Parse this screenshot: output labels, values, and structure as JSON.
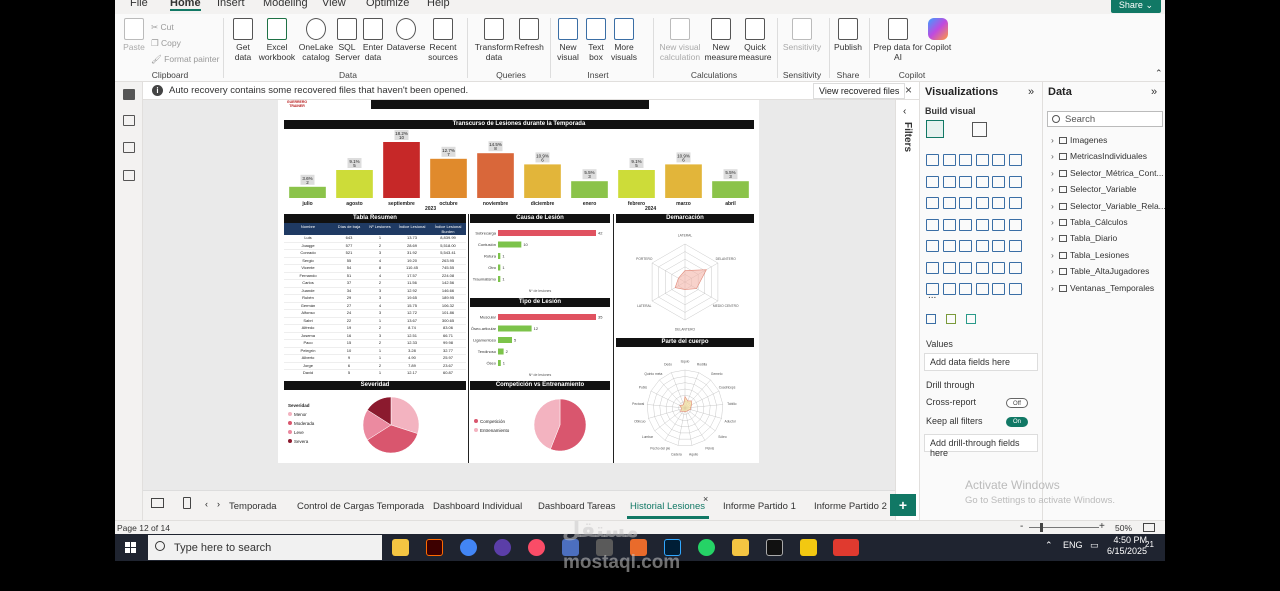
{
  "menu": {
    "items": [
      "File",
      "Home",
      "Insert",
      "Modeling",
      "View",
      "Optimize",
      "Help"
    ],
    "active": "Home",
    "share_label": "Share"
  },
  "ribbon": {
    "clipboard": {
      "paste": "Paste",
      "cut": "Cut",
      "copy": "Copy",
      "format_painter": "Format painter",
      "label": "Clipboard"
    },
    "data": {
      "get_data": "Get data",
      "excel": "Excel workbook",
      "onelake": "OneLake catalog",
      "sql": "SQL Server",
      "enter": "Enter data",
      "dataverse": "Dataverse",
      "recent": "Recent sources",
      "label": "Data"
    },
    "queries": {
      "transform": "Transform data",
      "refresh": "Refresh",
      "label": "Queries"
    },
    "insert": {
      "new_visual": "New visual",
      "text_box": "Text box",
      "more_visuals": "More visuals",
      "label": "Insert"
    },
    "calculations": {
      "new_visual_calc": "New visual calculation",
      "new_measure": "New measure",
      "quick_measure": "Quick measure",
      "label": "Calculations"
    },
    "sensitivity": {
      "sensitivity": "Sensitivity",
      "label": "Sensitivity"
    },
    "share": {
      "publish": "Publish",
      "label": "Share"
    },
    "copilot": {
      "prep": "Prep data for AI",
      "copilot": "Copilot",
      "label": "Copilot"
    }
  },
  "infobar": {
    "message": "Auto recovery contains some recovered files that haven't been opened.",
    "button": "View recovered files"
  },
  "report": {
    "logo_text": "GUERRERO TRAINER",
    "title_bar": "Transcurso de Lesiones durante la Temporada",
    "year_left": "2023",
    "year_right": "2024",
    "tabla_resumen": "Tabla Resumen",
    "causa_title": "Causa de Lesión",
    "tipo_title": "Tipo de Lesión",
    "demarcacion_title": "Demarcación",
    "parte_title": "Parte del cuerpo",
    "severidad_title": "Severidad",
    "comp_title": "Competición vs Entrenamiento",
    "n_lesiones": "Nº de lesiones",
    "table_headers": [
      "Nombre",
      "Días de baja",
      "Nº Lesiones",
      "Índice Lesional",
      "Índice Lesional Burden"
    ],
    "table_rows": [
      [
        "Luis",
        "643",
        "1",
        "13.73",
        "8,839.99"
      ],
      [
        "Joaqge",
        "577",
        "2",
        "28.69",
        "5,518.00"
      ],
      [
        "Conrado",
        "521",
        "3",
        "31.92",
        "5,543.41"
      ],
      [
        "Sergio",
        "55",
        "4",
        "19.20",
        "263.95"
      ],
      [
        "Vicente",
        "54",
        "8",
        "110.45",
        "745.55"
      ],
      [
        "Fernando",
        "51",
        "4",
        "17.57",
        "224.08"
      ],
      [
        "Carlos",
        "37",
        "2",
        "11.56",
        "142.56"
      ],
      [
        "Juande",
        "34",
        "3",
        "12.92",
        "146.66"
      ],
      [
        "Rubén",
        "29",
        "3",
        "19.65",
        "189.95"
      ],
      [
        "Germán",
        "27",
        "4",
        "15.75",
        "106.32"
      ],
      [
        "Alfonso",
        "24",
        "3",
        "12.72",
        "101.86"
      ],
      [
        "Sabri",
        "22",
        "1",
        "13.67",
        "300.65"
      ],
      [
        "Alfredo",
        "19",
        "2",
        "8.74",
        "83.06"
      ],
      [
        "Josema",
        "16",
        "3",
        "12.51",
        "66.71"
      ],
      [
        "Paco",
        "15",
        "2",
        "12.33",
        "99.98"
      ],
      [
        "Pelegrín",
        "10",
        "1",
        "3.28",
        "32.77"
      ],
      [
        "Alberto",
        "9",
        "1",
        "4.90",
        "25.97"
      ],
      [
        "Jorge",
        "6",
        "2",
        "7.89",
        "23.67"
      ],
      [
        "David",
        "5",
        "1",
        "12.17",
        "60.87"
      ],
      [
        "Patricio",
        "5",
        "1",
        "3.78",
        "18.90"
      ],
      [
        "Rafa",
        "4",
        "1",
        "4.78",
        "19.13"
      ]
    ],
    "causa_categories": [
      "Sobrecarga",
      "Contusión",
      "Rotura",
      "Otro",
      "Traumatismo"
    ],
    "causa_values": [
      42,
      10,
      1,
      1,
      1
    ],
    "tipo_categories": [
      "Muscular",
      "Óseo-articular",
      "Ligamentoso",
      "Tendinoso",
      "Óseo"
    ],
    "tipo_values": [
      35,
      12,
      5,
      2,
      1
    ],
    "demarcacion_labels": [
      "LATERAL",
      "DELANTERO",
      "MEDIO CENTRO",
      "DELANTERO",
      "LATERAL",
      "PORTERO"
    ],
    "parte_labels": [
      "Isquio",
      "Rodilla",
      "Gemelo",
      "Cuadriceps",
      "Tobillo",
      "Aductor",
      "Sóleo",
      "Pelvis",
      "Aquilo",
      "Cadera",
      "Pecho del pie",
      "Lumbar",
      "Oblícuo",
      "Pectoral",
      "Pubis",
      "Quinto meta",
      "Dedo"
    ],
    "severidad_legend_title": "Severidad",
    "severidad_legend": [
      "Menor",
      "Moderada",
      "Leve",
      "Severa"
    ],
    "comp_legend": [
      "Competición",
      "Entrenamiento"
    ]
  },
  "chart_data": {
    "type": "bar",
    "categories": [
      "julio",
      "agosto",
      "septiembre",
      "octubre",
      "noviembre",
      "diciembre",
      "enero",
      "febrero",
      "marzo",
      "abril"
    ],
    "values": [
      2,
      5,
      10,
      7,
      8,
      6,
      3,
      5,
      6,
      3
    ],
    "percent_labels": [
      "3.6%",
      "9.1%",
      "18.2%",
      "12.7%",
      "14.5%",
      "10.9%",
      "5.5%",
      "9.1%",
      "10.9%",
      "5.5%"
    ],
    "colors": [
      "#8bc34a",
      "#cddc39",
      "#c62828",
      "#e08a2c",
      "#d9673a",
      "#e2b53a",
      "#8bc34a",
      "#cddc39",
      "#e2b53a",
      "#8bc34a"
    ],
    "title": "Transcurso de Lesiones durante la Temporada",
    "ylim": [
      0,
      10
    ]
  },
  "filters": {
    "label": "Filters"
  },
  "visualizations": {
    "title": "Visualizations",
    "build_visual": "Build visual",
    "more": "...",
    "values": "Values",
    "add_data_fields": "Add data fields here",
    "drill_through": "Drill through",
    "cross_report": "Cross-report",
    "cross_report_state": "Off",
    "keep_all_filters": "Keep all filters",
    "keep_all_filters_state": "On",
    "add_drill_fields": "Add drill-through fields here"
  },
  "data_pane": {
    "title": "Data",
    "search_placeholder": "Search",
    "tables": [
      "Imagenes",
      "MetricasIndividuales",
      "Selector_Métrica_Cont...",
      "Selector_Variable",
      "Selector_Variable_Rela...",
      "Tabla_Cálculos",
      "Tabla_Diario",
      "Tabla_Lesiones",
      "Table_AltaJugadores",
      "Ventanas_Temporales"
    ]
  },
  "activate": {
    "line1": "Activate Windows",
    "line2": "Go to Settings to activate Windows."
  },
  "tabs": {
    "items": [
      "Temporada",
      "Control de Cargas Temporada",
      "Dashboard Individual",
      "Dashboard Tareas",
      "Historial Lesiones",
      "Informe Partido 1",
      "Informe Partido 2"
    ],
    "active": "Historial Lesiones",
    "add": "+"
  },
  "status": {
    "page": "Page 12 of 14",
    "zoom": "50%"
  },
  "taskbar": {
    "search_placeholder": "Type here to search",
    "time": "4:50 PM",
    "date": "6/15/2025",
    "lang": "ENG",
    "notifications": "21"
  },
  "watermark": {
    "arabic": "مستقل",
    "latin": "mostaql.com"
  }
}
